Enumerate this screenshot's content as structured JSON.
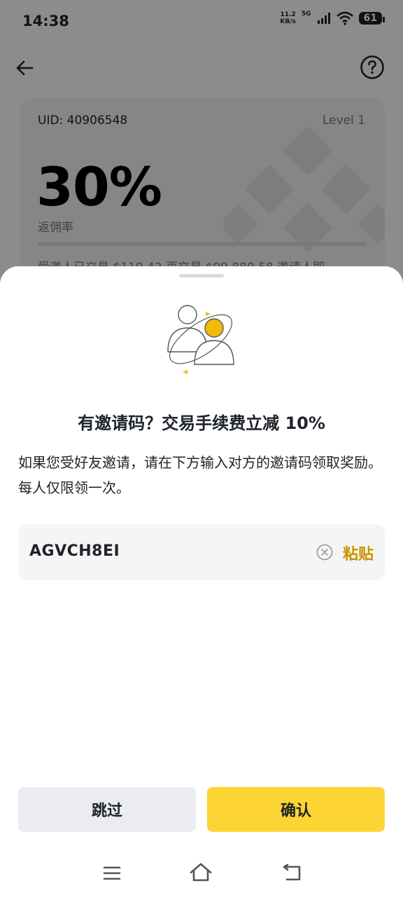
{
  "status_bar": {
    "time": "14:38",
    "net_speed_value": "11.2",
    "net_speed_unit": "KB/s",
    "network": "5G",
    "battery": "61"
  },
  "card": {
    "uid": "UID: 40906548",
    "level": "Level 1",
    "rate": "30%",
    "rate_label": "返佣率",
    "stats": "受邀人已交易 $119.42   再交易 $99,880.58   邀请人即"
  },
  "sheet": {
    "title": "有邀请码？交易手续费立减 10%",
    "description": "如果您受好友邀请，请在下方输入对方的邀请码领取奖励。每人仅限领一次。",
    "code_value": "AGVCH8EI",
    "paste_label": "粘贴",
    "skip_label": "跳过",
    "confirm_label": "确认"
  },
  "colors": {
    "accent": "#fcd535",
    "paste": "#c99400"
  },
  "icons": [
    "back-arrow-icon",
    "help-icon",
    "clear-icon",
    "menu-icon",
    "home-icon",
    "back-nav-icon"
  ]
}
